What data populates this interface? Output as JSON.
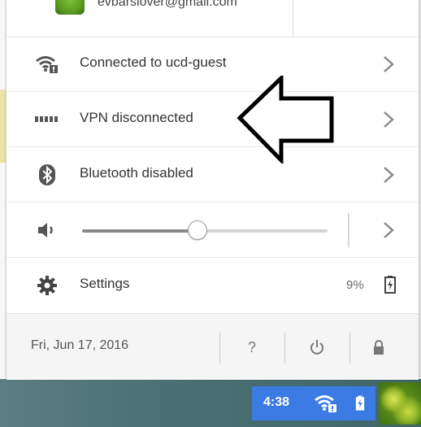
{
  "account": {
    "email": "evbarslover@gmail.com"
  },
  "rows": {
    "network": {
      "label": "Connected to ucd-guest",
      "icon": "wifi-locked-icon"
    },
    "vpn": {
      "label": "VPN disconnected",
      "icon": "vpn-icon"
    },
    "bluetooth": {
      "label": "Bluetooth disabled",
      "icon": "bluetooth-icon"
    },
    "volume": {
      "icon": "speaker-icon",
      "level": 0.47
    },
    "settings": {
      "label": "Settings",
      "icon": "gear-icon"
    }
  },
  "battery": {
    "percent_text": "9%"
  },
  "footer": {
    "date": "Fri, Jun 17, 2016",
    "help_label": "?"
  },
  "shelf": {
    "time": "4:38",
    "accent": "#3c7be3"
  }
}
